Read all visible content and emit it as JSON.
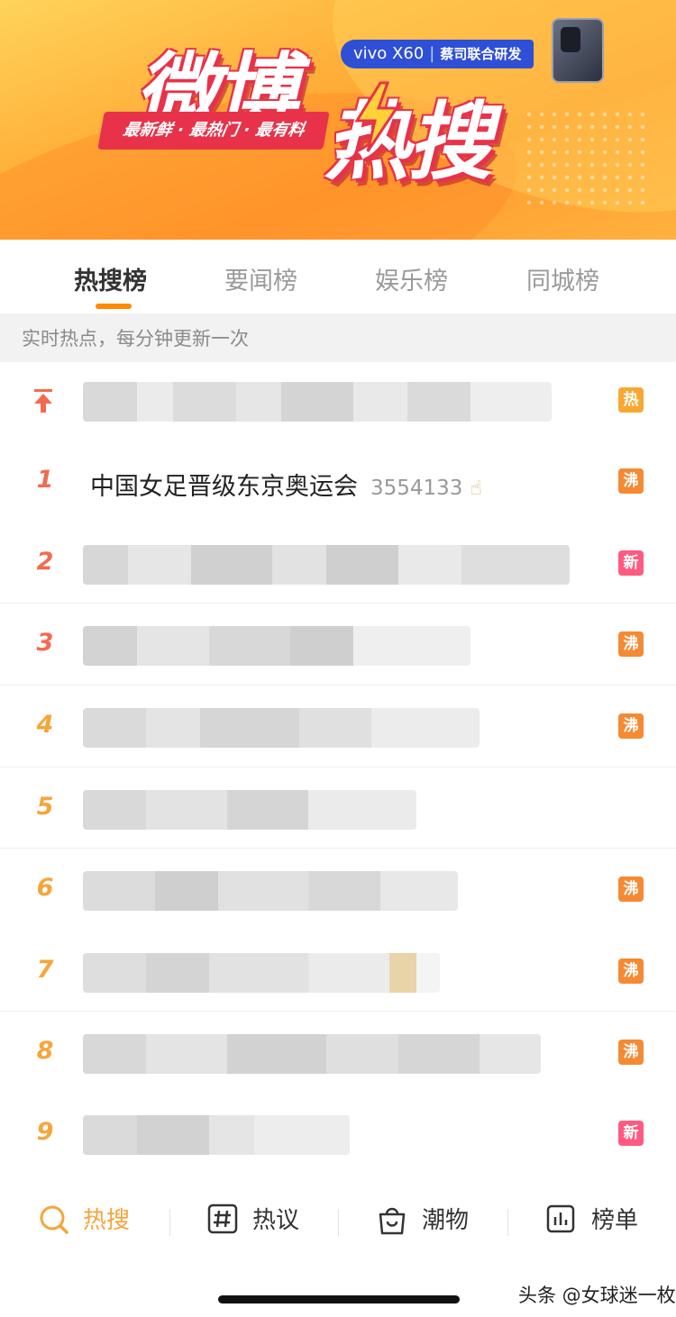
{
  "banner": {
    "title_weibo": "微博",
    "title_resou": "热搜",
    "slogan": "最新鲜 · 最热门 · 最有料",
    "promo_brand": "vivo X60",
    "promo_sub": "蔡司联合研发"
  },
  "tabs": [
    {
      "label": "热搜榜",
      "active": true
    },
    {
      "label": "要闻榜",
      "active": false
    },
    {
      "label": "娱乐榜",
      "active": false
    },
    {
      "label": "同城榜",
      "active": false
    }
  ],
  "info_bar": "实时热点，每分钟更新一次",
  "list": [
    {
      "rank": "pinned",
      "title": "",
      "badge": "热"
    },
    {
      "rank": "1",
      "title": "中国女足晋级东京奥运会",
      "count": "3554133",
      "badge": "沸"
    },
    {
      "rank": "2",
      "title": "",
      "badge": "新"
    },
    {
      "rank": "3",
      "title": "",
      "badge": "沸"
    },
    {
      "rank": "4",
      "title": "",
      "badge": "沸"
    },
    {
      "rank": "5",
      "title": "",
      "badge": ""
    },
    {
      "rank": "6",
      "title": "",
      "badge": "沸"
    },
    {
      "rank": "7",
      "title": "",
      "badge": "沸"
    },
    {
      "rank": "8",
      "title": "",
      "badge": "沸"
    },
    {
      "rank": "9",
      "title": "",
      "badge": "新"
    }
  ],
  "bottom_nav": [
    {
      "label": "热搜",
      "icon": "search-icon",
      "active": true
    },
    {
      "label": "热议",
      "icon": "hashtag-icon",
      "active": false
    },
    {
      "label": "潮物",
      "icon": "shopping-bag-icon",
      "active": false
    },
    {
      "label": "榜单",
      "icon": "chart-icon",
      "active": false
    }
  ],
  "watermark": "头条 @女球迷一枚",
  "colors": {
    "accent": "#ff8a00",
    "badge_hot": "#f7a833",
    "badge_boil": "#f58a34",
    "badge_new": "#ff5a80",
    "rank_top": "#f36b4e"
  }
}
